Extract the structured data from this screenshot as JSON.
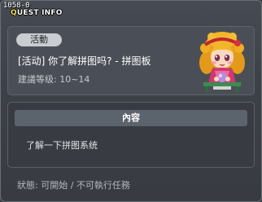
{
  "header": {
    "quest_id": "1058-0",
    "title": "QUEST INFO",
    "title_rest": "UEST INFO",
    "title_first": "Q"
  },
  "quest": {
    "category_tag": "活動",
    "name": "[活动] 你了解拼图吗? - 拼图板",
    "level": "建議等级: 10~14",
    "npc_icon": "npc-girl-portrait-icon"
  },
  "content": {
    "heading": "內容",
    "body": "了解一下拼图系统"
  },
  "status": {
    "text": "狀態: 可開始 / 不可執行任務"
  },
  "colors": {
    "accent_yellow": "#f5e060",
    "panel": "#4a4f57",
    "background": "#3d4148"
  }
}
